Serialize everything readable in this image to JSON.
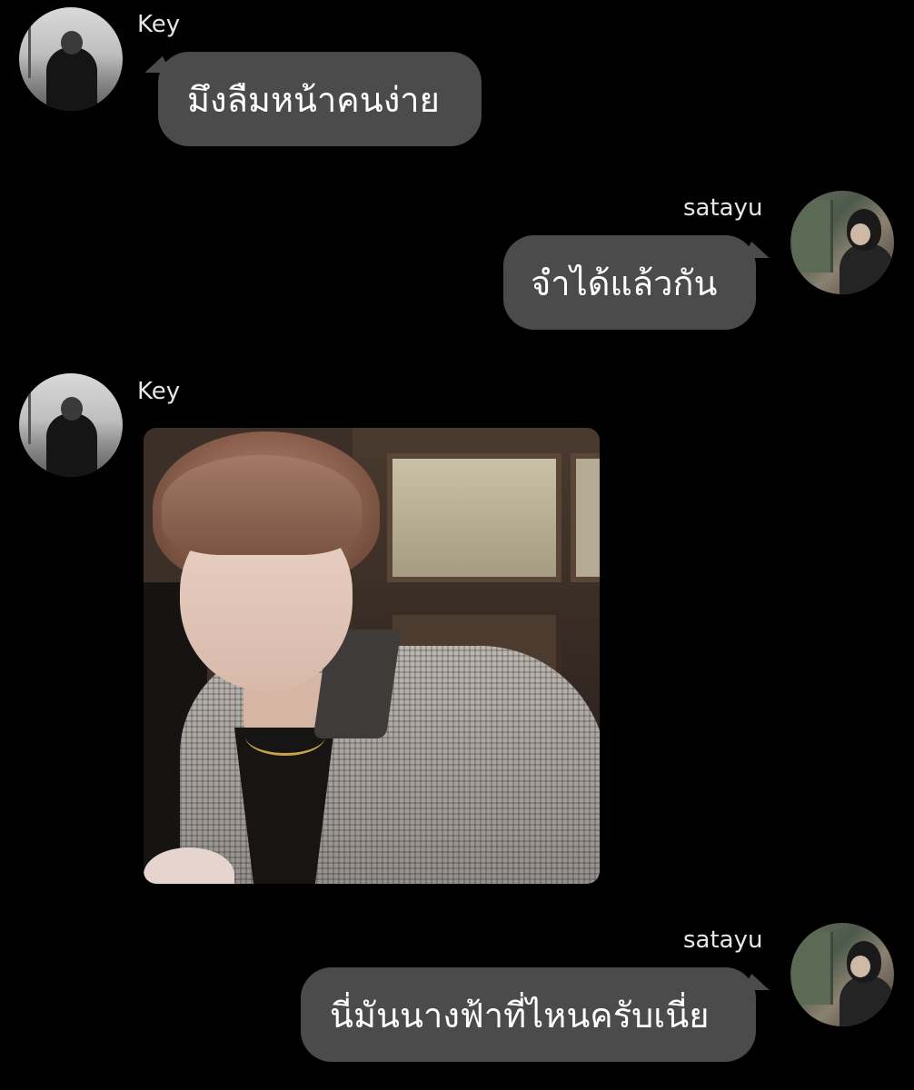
{
  "messages": [
    {
      "sender": "Key",
      "side": "left",
      "type": "text",
      "text": "มึงลืมหน้าคนง่าย"
    },
    {
      "sender": "satayu",
      "side": "right",
      "type": "text",
      "text": "จำได้แล้วกัน"
    },
    {
      "sender": "Key",
      "side": "left",
      "type": "image",
      "text": ""
    },
    {
      "sender": "satayu",
      "side": "right",
      "type": "text",
      "text": "นี่มันนางฟ้าที่ไหนครับเนี่ย"
    }
  ],
  "colors": {
    "background": "#000000",
    "bubble": "#4b4b4b",
    "text": "#ffffff",
    "name": "#e6e6e6"
  }
}
